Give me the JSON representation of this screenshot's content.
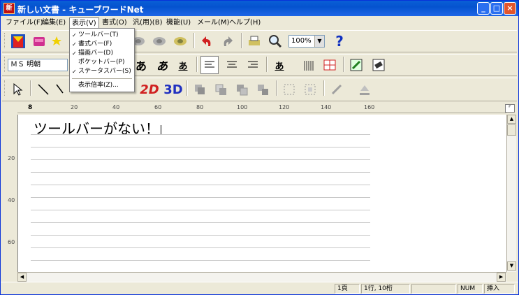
{
  "window": {
    "title": "新しい文書 - キューブワードNet",
    "app_icon": "新"
  },
  "menubar": [
    {
      "label": "ファイル(F)"
    },
    {
      "label": "編集(E)"
    },
    {
      "label": "表示(V)"
    },
    {
      "label": "書式(O)"
    },
    {
      "label": "汎(用)(B)"
    },
    {
      "label": "機能(U)"
    },
    {
      "label": "メール(M)"
    },
    {
      "label": "ヘルプ(H)"
    }
  ],
  "view_menu": {
    "items": [
      {
        "label": "ツールバー(T)",
        "checked": true
      },
      {
        "label": "書式バー(F)",
        "checked": true
      },
      {
        "label": "描画バー(D)",
        "checked": true
      },
      {
        "label": "ポケットバー(P)",
        "checked": false
      },
      {
        "label": "ステータスバー(S)",
        "checked": true
      }
    ],
    "zoom_label": "表示倍率(Z)..."
  },
  "toolbar": {
    "zoom_value": "100%",
    "help_glyph": "?"
  },
  "format_bar": {
    "font_name": "ＭＳ 明朝",
    "char_a1": "あ",
    "char_a2": "あ",
    "char_a3": "あ",
    "char_a4": "あ"
  },
  "draw_bar": {
    "label_2d": "2D",
    "label_3d": "3D"
  },
  "ruler": {
    "marks": [
      "20",
      "40",
      "60",
      "80",
      "100",
      "120",
      "140",
      "160"
    ],
    "vmarks": [
      "20",
      "40",
      "60"
    ],
    "corner": "⌜"
  },
  "document": {
    "text": "ツールバーがない！"
  },
  "statusbar": {
    "page": "1頁",
    "position": "1行, 10桁",
    "num": "NUM",
    "mode": "挿入"
  }
}
